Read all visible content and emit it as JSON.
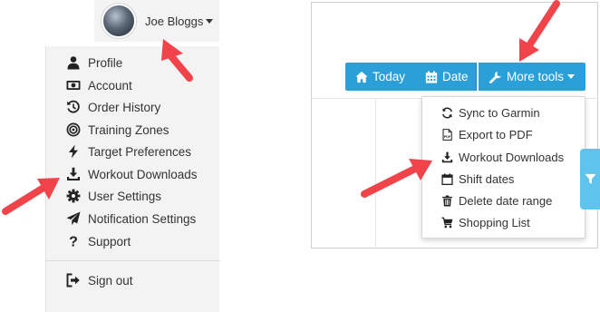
{
  "user": {
    "name": "Joe Bloggs",
    "avatar_icon": "avatar-photo"
  },
  "user_menu": {
    "items": [
      {
        "label": "Profile",
        "icon": "user-icon"
      },
      {
        "label": "Account",
        "icon": "money-icon"
      },
      {
        "label": "Order History",
        "icon": "history-icon"
      },
      {
        "label": "Training Zones",
        "icon": "target-icon"
      },
      {
        "label": "Target Preferences",
        "icon": "bolt-icon"
      },
      {
        "label": "Workout Downloads",
        "icon": "download-icon"
      },
      {
        "label": "User Settings",
        "icon": "gear-icon"
      },
      {
        "label": "Notification Settings",
        "icon": "paper-plane-icon"
      },
      {
        "label": "Support",
        "icon": "question-icon"
      }
    ],
    "sign_out": {
      "label": "Sign out",
      "icon": "sign-out-icon"
    }
  },
  "toolbar": {
    "today_label": "Today",
    "date_label": "Date",
    "more_tools_label": "More tools"
  },
  "tools_menu": {
    "items": [
      {
        "label": "Sync to Garmin",
        "icon": "sync-icon"
      },
      {
        "label": "Export to PDF",
        "icon": "pdf-file-icon"
      },
      {
        "label": "Workout Downloads",
        "icon": "download-icon"
      },
      {
        "label": "Shift dates",
        "icon": "calendar-icon"
      },
      {
        "label": "Delete date range",
        "icon": "trash-icon"
      },
      {
        "label": "Shopping List",
        "icon": "cart-icon"
      }
    ]
  },
  "filter": {
    "icon": "filter-icon"
  },
  "colors": {
    "accent": "#2b9fd8",
    "filter_tab": "#5ec4ec",
    "annotation_arrow": "#f0434a",
    "menu_background": "#f3f3f3"
  }
}
